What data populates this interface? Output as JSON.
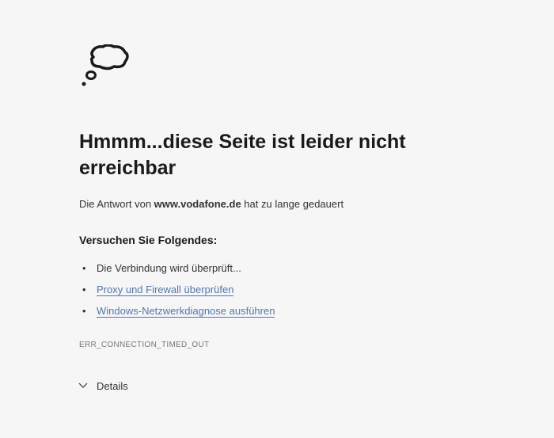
{
  "title": "Hmmm...diese Seite ist leider nicht erreichbar",
  "message_prefix": "Die Antwort von ",
  "domain": "www.vodafone.de",
  "message_suffix": " hat zu lange gedauert",
  "subtitle": "Versuchen Sie Folgendes:",
  "suggestions": {
    "item0": "Die Verbindung wird überprüft...",
    "item1": "Proxy und Firewall überprüfen",
    "item2": "Windows-Netzwerkdiagnose ausführen"
  },
  "error_code": "ERR_CONNECTION_TIMED_OUT",
  "details_label": "Details"
}
